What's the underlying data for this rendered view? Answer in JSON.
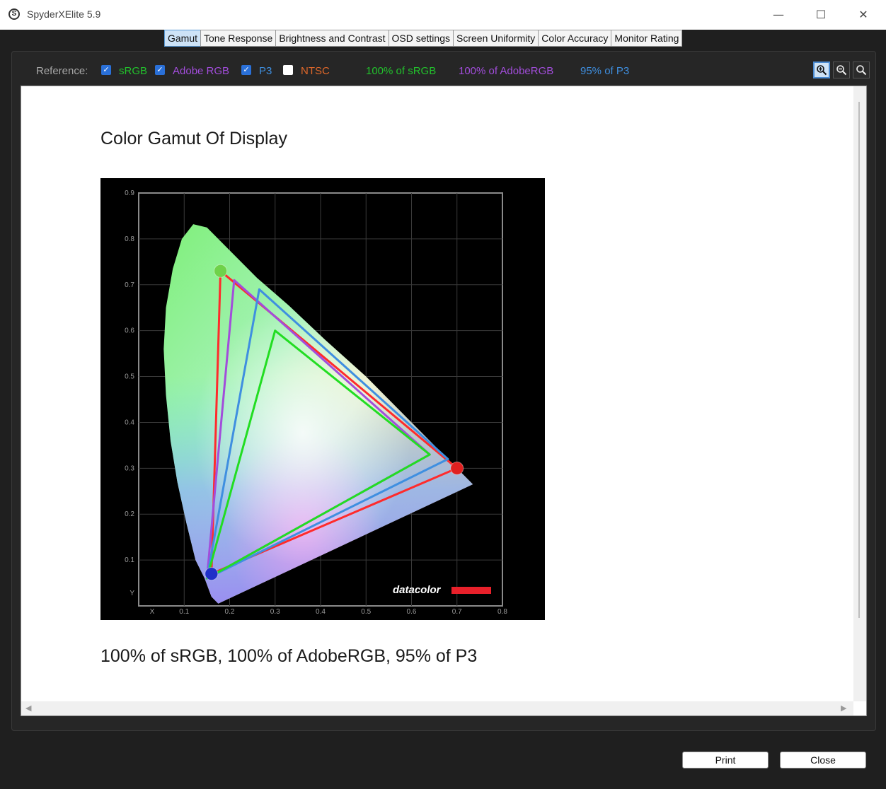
{
  "window": {
    "title": "SpyderXElite 5.9",
    "app_icon_letter": "S",
    "minimize": "—",
    "maximize": "☐",
    "close": "✕"
  },
  "tabs": [
    {
      "label": "Gamut",
      "active": true
    },
    {
      "label": "Tone Response"
    },
    {
      "label": "Brightness and Contrast"
    },
    {
      "label": "OSD settings"
    },
    {
      "label": "Screen Uniformity"
    },
    {
      "label": "Color Accuracy"
    },
    {
      "label": "Monitor Rating"
    }
  ],
  "reference": {
    "label": "Reference:",
    "items": [
      {
        "label": "sRGB",
        "checked": true,
        "color": "#22c22c"
      },
      {
        "label": "Adobe RGB",
        "checked": true,
        "color": "#a24ddb"
      },
      {
        "label": "P3",
        "checked": true,
        "color": "#3f8fe0"
      },
      {
        "label": "NTSC",
        "checked": false,
        "color": "#e0682a"
      }
    ],
    "results": [
      {
        "text": "100% of sRGB",
        "color": "#22c22c"
      },
      {
        "text": "100% of AdobeRGB",
        "color": "#a24ddb"
      },
      {
        "text": "95% of P3",
        "color": "#3f8fe0"
      }
    ]
  },
  "zoom_icons": [
    "zoom-in-icon",
    "zoom-out-icon",
    "zoom-fit-icon"
  ],
  "report": {
    "title": "Color Gamut Of Display",
    "summary": "100% of sRGB, 100% of AdobeRGB, 95% of P3",
    "watermark": "datacolor"
  },
  "chart_data": {
    "type": "scatter",
    "title": "",
    "xlabel": "X",
    "ylabel": "Y",
    "xlim": [
      0,
      0.8
    ],
    "ylim": [
      0,
      0.9
    ],
    "x_ticks": [
      "0.1",
      "0.2",
      "0.3",
      "0.4",
      "0.5",
      "0.6",
      "0.7",
      "0.8"
    ],
    "y_ticks": [
      "0.1",
      "0.2",
      "0.3",
      "0.4",
      "0.5",
      "0.6",
      "0.7",
      "0.8",
      "0.9"
    ],
    "grid": true,
    "series": [
      {
        "color": "#ff2b2b",
        "points": [
          [
            0.7,
            0.3
          ],
          [
            0.18,
            0.73
          ],
          [
            0.16,
            0.07
          ]
        ]
      },
      {
        "color": "#a24ddb",
        "points": [
          [
            0.64,
            0.33
          ],
          [
            0.21,
            0.71
          ],
          [
            0.15,
            0.06
          ]
        ]
      },
      {
        "color": "#3f8fe0",
        "points": [
          [
            0.68,
            0.32
          ],
          [
            0.265,
            0.69
          ],
          [
            0.15,
            0.06
          ]
        ]
      },
      {
        "color": "#22dd22",
        "points": [
          [
            0.64,
            0.33
          ],
          [
            0.3,
            0.6
          ],
          [
            0.15,
            0.06
          ]
        ]
      }
    ],
    "primaries": [
      {
        "x": 0.18,
        "y": 0.73,
        "color": "#6fd24a"
      },
      {
        "x": 0.7,
        "y": 0.3,
        "color": "#e02020"
      },
      {
        "x": 0.16,
        "y": 0.07,
        "color": "#2030c8"
      }
    ]
  },
  "buttons": {
    "print": "Print",
    "close": "Close"
  }
}
